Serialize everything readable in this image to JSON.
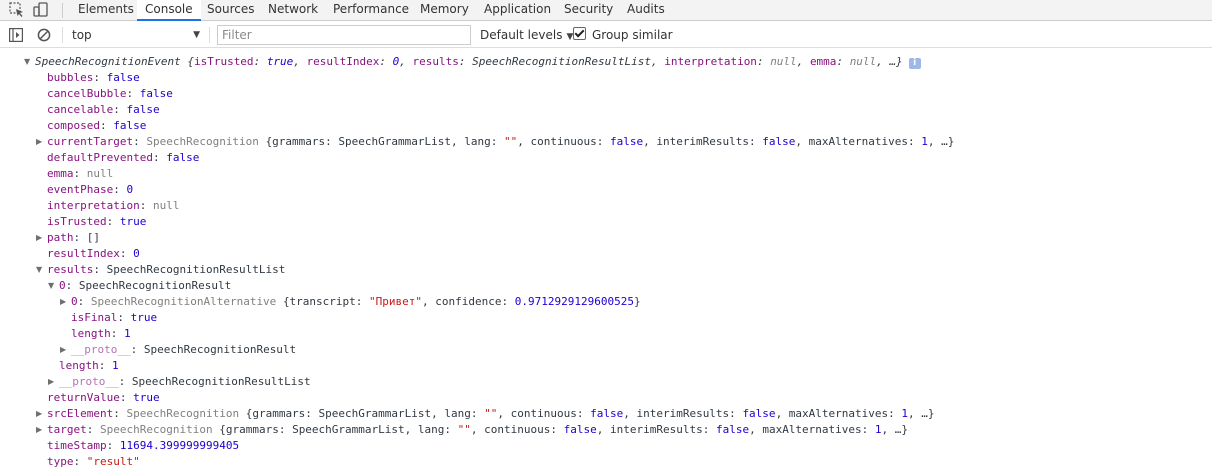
{
  "tabs": [
    "Elements",
    "Console",
    "Sources",
    "Network",
    "Performance",
    "Memory",
    "Application",
    "Security",
    "Audits"
  ],
  "active_tab": "Console",
  "toolbar": {
    "context": "top",
    "filter_placeholder": "Filter",
    "levels_label": "Default levels",
    "group_similar_label": "Group similar",
    "group_similar_checked": true
  },
  "log": {
    "header": {
      "cls": "SpeechRecognitionEvent",
      "preview": [
        {
          "k": "isTrusted",
          "v": "true",
          "t": "n"
        },
        {
          "k": "resultIndex",
          "v": "0",
          "t": "n"
        },
        {
          "k": "results",
          "v": "SpeechRecognitionResultList",
          "t": "o"
        },
        {
          "k": "interpretation",
          "v": "null",
          "t": "nul"
        },
        {
          "k": "emma",
          "v": "null",
          "t": "nul"
        }
      ]
    },
    "lines": [
      {
        "d": 0,
        "tri": "",
        "key": "bubbles",
        "parts": [
          {
            "t": "n",
            "v": "false"
          }
        ]
      },
      {
        "d": 0,
        "tri": "",
        "key": "cancelBubble",
        "parts": [
          {
            "t": "n",
            "v": "false"
          }
        ]
      },
      {
        "d": 0,
        "tri": "",
        "key": "cancelable",
        "parts": [
          {
            "t": "n",
            "v": "false"
          }
        ]
      },
      {
        "d": 0,
        "tri": "",
        "key": "composed",
        "parts": [
          {
            "t": "n",
            "v": "false"
          }
        ]
      },
      {
        "d": 0,
        "tri": "right",
        "key": "currentTarget",
        "parts": [
          {
            "t": "nul",
            "v": "SpeechRecognition "
          },
          {
            "t": "o",
            "v": "{grammars: SpeechGrammarList, lang: "
          },
          {
            "t": "s",
            "v": "\"\""
          },
          {
            "t": "o",
            "v": ", continuous: "
          },
          {
            "t": "n",
            "v": "false"
          },
          {
            "t": "o",
            "v": ", interimResults: "
          },
          {
            "t": "n",
            "v": "false"
          },
          {
            "t": "o",
            "v": ", maxAlternatives: "
          },
          {
            "t": "n",
            "v": "1"
          },
          {
            "t": "o",
            "v": ", …}"
          }
        ]
      },
      {
        "d": 0,
        "tri": "",
        "key": "defaultPrevented",
        "parts": [
          {
            "t": "n",
            "v": "false"
          }
        ]
      },
      {
        "d": 0,
        "tri": "",
        "key": "emma",
        "parts": [
          {
            "t": "nul",
            "v": "null"
          }
        ]
      },
      {
        "d": 0,
        "tri": "",
        "key": "eventPhase",
        "parts": [
          {
            "t": "n",
            "v": "0"
          }
        ]
      },
      {
        "d": 0,
        "tri": "",
        "key": "interpretation",
        "parts": [
          {
            "t": "nul",
            "v": "null"
          }
        ]
      },
      {
        "d": 0,
        "tri": "",
        "key": "isTrusted",
        "parts": [
          {
            "t": "n",
            "v": "true"
          }
        ]
      },
      {
        "d": 0,
        "tri": "right",
        "key": "path",
        "parts": [
          {
            "t": "o",
            "v": "[]"
          }
        ]
      },
      {
        "d": 0,
        "tri": "",
        "key": "resultIndex",
        "parts": [
          {
            "t": "n",
            "v": "0"
          }
        ]
      },
      {
        "d": 0,
        "tri": "down",
        "key": "results",
        "parts": [
          {
            "t": "o",
            "v": "SpeechRecognitionResultList"
          }
        ]
      },
      {
        "d": 1,
        "tri": "down",
        "key": "0",
        "parts": [
          {
            "t": "o",
            "v": "SpeechRecognitionResult"
          }
        ]
      },
      {
        "d": 2,
        "tri": "right",
        "key": "0",
        "parts": [
          {
            "t": "nul",
            "v": "SpeechRecognitionAlternative "
          },
          {
            "t": "o",
            "v": "{transcript: "
          },
          {
            "t": "s",
            "v": "\"Привет\""
          },
          {
            "t": "o",
            "v": ", confidence: "
          },
          {
            "t": "n",
            "v": "0.9712929129600525"
          },
          {
            "t": "o",
            "v": "}"
          }
        ]
      },
      {
        "d": 2,
        "tri": "",
        "key": "isFinal",
        "parts": [
          {
            "t": "n",
            "v": "true"
          }
        ]
      },
      {
        "d": 2,
        "tri": "",
        "key": "length",
        "parts": [
          {
            "t": "n",
            "v": "1"
          }
        ]
      },
      {
        "d": 2,
        "tri": "right",
        "key": "__proto__",
        "dim": true,
        "parts": [
          {
            "t": "o",
            "v": "SpeechRecognitionResult"
          }
        ]
      },
      {
        "d": 1,
        "tri": "",
        "key": "length",
        "parts": [
          {
            "t": "n",
            "v": "1"
          }
        ]
      },
      {
        "d": 1,
        "tri": "right",
        "key": "__proto__",
        "dim": true,
        "parts": [
          {
            "t": "o",
            "v": "SpeechRecognitionResultList"
          }
        ]
      },
      {
        "d": 0,
        "tri": "",
        "key": "returnValue",
        "parts": [
          {
            "t": "n",
            "v": "true"
          }
        ]
      },
      {
        "d": 0,
        "tri": "right",
        "key": "srcElement",
        "parts": [
          {
            "t": "nul",
            "v": "SpeechRecognition "
          },
          {
            "t": "o",
            "v": "{grammars: SpeechGrammarList, lang: "
          },
          {
            "t": "s",
            "v": "\"\""
          },
          {
            "t": "o",
            "v": ", continuous: "
          },
          {
            "t": "n",
            "v": "false"
          },
          {
            "t": "o",
            "v": ", interimResults: "
          },
          {
            "t": "n",
            "v": "false"
          },
          {
            "t": "o",
            "v": ", maxAlternatives: "
          },
          {
            "t": "n",
            "v": "1"
          },
          {
            "t": "o",
            "v": ", …}"
          }
        ]
      },
      {
        "d": 0,
        "tri": "right",
        "key": "target",
        "parts": [
          {
            "t": "nul",
            "v": "SpeechRecognition "
          },
          {
            "t": "o",
            "v": "{grammars: SpeechGrammarList, lang: "
          },
          {
            "t": "s",
            "v": "\"\""
          },
          {
            "t": "o",
            "v": ", continuous: "
          },
          {
            "t": "n",
            "v": "false"
          },
          {
            "t": "o",
            "v": ", interimResults: "
          },
          {
            "t": "n",
            "v": "false"
          },
          {
            "t": "o",
            "v": ", maxAlternatives: "
          },
          {
            "t": "n",
            "v": "1"
          },
          {
            "t": "o",
            "v": ", …}"
          }
        ]
      },
      {
        "d": 0,
        "tri": "",
        "key": "timeStamp",
        "parts": [
          {
            "t": "n",
            "v": "11694.399999999405"
          }
        ]
      },
      {
        "d": 0,
        "tri": "",
        "key": "type",
        "parts": [
          {
            "t": "s",
            "v": "\"result\""
          }
        ]
      }
    ]
  },
  "colors": {
    "accent": "#1a73e8",
    "key": "#881280",
    "number": "#1c00cf",
    "string": "#c41a16",
    "null": "#808080"
  }
}
